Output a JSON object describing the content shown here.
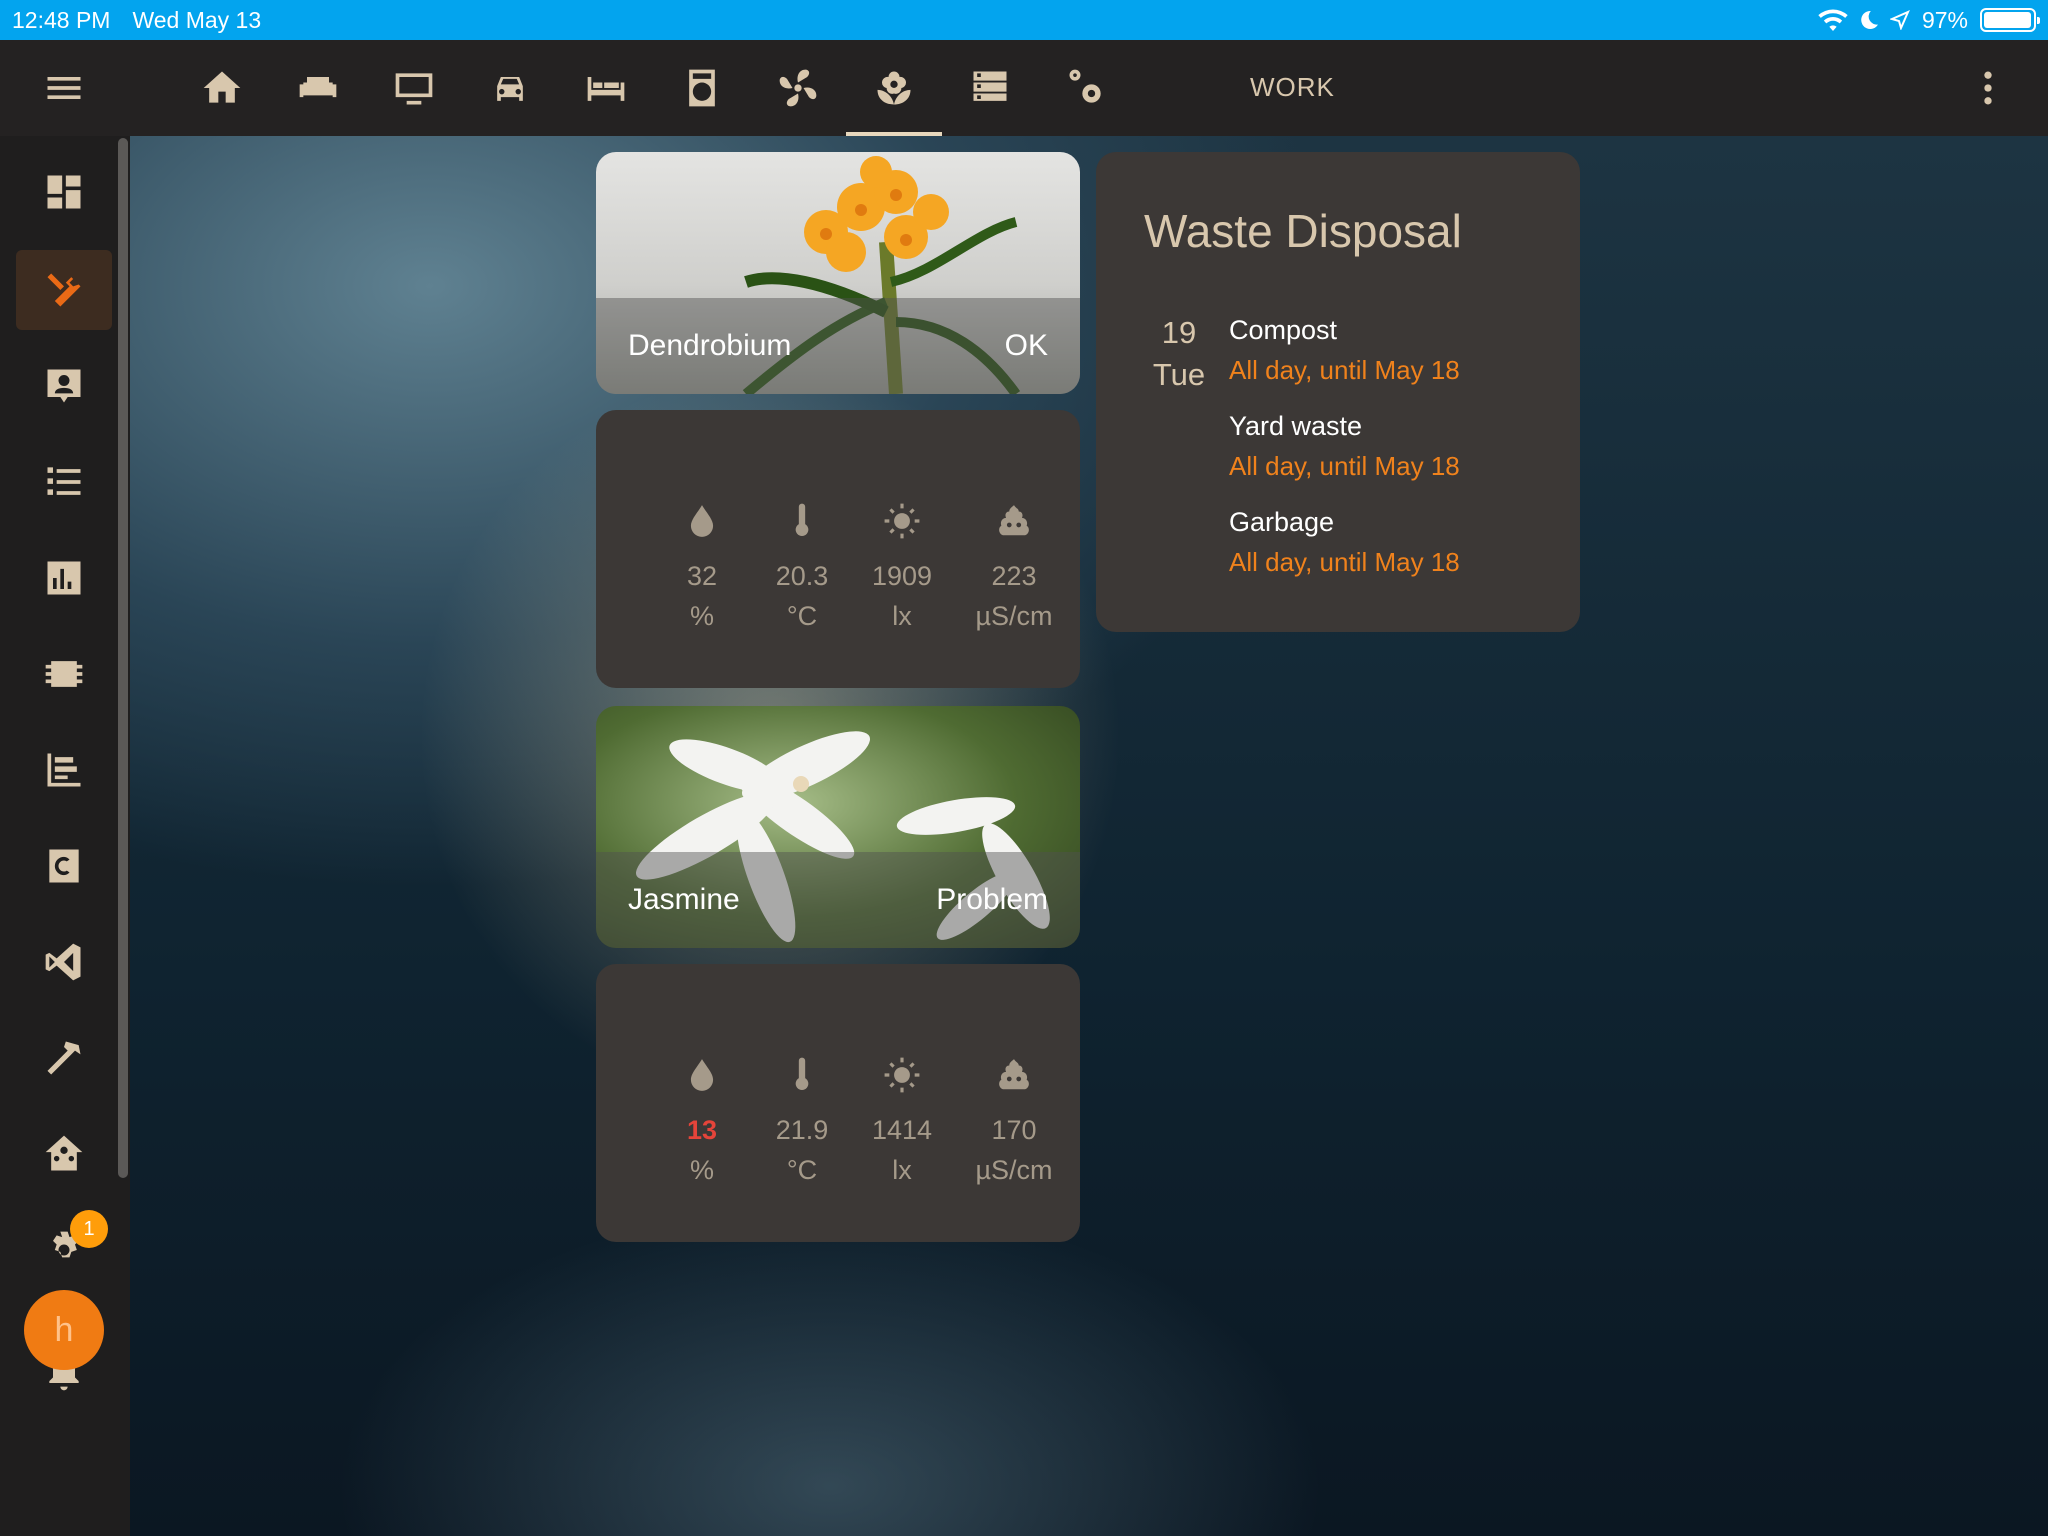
{
  "status": {
    "time": "12:48 PM",
    "date": "Wed May 13",
    "battery": "97%",
    "battery_level": 0.97
  },
  "toolbar": {
    "view_label": "WORK",
    "tabs": [
      "home-icon",
      "sofa-icon",
      "monitor-icon",
      "car-icon",
      "bed-icon",
      "washing-machine-icon",
      "fan-icon",
      "flower-icon",
      "server-icon",
      "cogs-icon"
    ],
    "active_tab": "flower-icon"
  },
  "sidebar": {
    "items": [
      "dashboard-icon",
      "tools-icon",
      "account-box-icon",
      "list-icon",
      "chart-icon",
      "chip-icon",
      "timeline-icon",
      "c-icon",
      "vscode-icon",
      "hammer-icon",
      "home-assistant-icon",
      "settings-icon"
    ],
    "active": "tools-icon",
    "notification_count": "1",
    "avatar_letter": "h"
  },
  "plants": [
    {
      "name": "Dendrobium",
      "status": "OK",
      "moisture": "32",
      "moisture_unit": "%",
      "temperature": "20.3",
      "temperature_unit": "°C",
      "illuminance": "1909",
      "illuminance_unit": "lx",
      "conductivity": "223",
      "conductivity_unit": "µS/cm"
    },
    {
      "name": "Jasmine",
      "status": "Problem",
      "moisture": "13",
      "moisture_unit": "%",
      "temperature": "21.9",
      "temperature_unit": "°C",
      "illuminance": "1414",
      "illuminance_unit": "lx",
      "conductivity": "170",
      "conductivity_unit": "µS/cm"
    }
  ],
  "waste": {
    "title": "Waste Disposal",
    "day": "19",
    "weekday": "Tue",
    "events": [
      {
        "name": "Compost",
        "when": "All day, until May 18"
      },
      {
        "name": "Yard waste",
        "when": "All day, until May 18"
      },
      {
        "name": "Garbage",
        "when": "All day, until May 18"
      }
    ]
  },
  "colors": {
    "accent": "#f0821c",
    "alert": "#e5443a",
    "statusbar": "#03a4ee",
    "card": "#3c3836"
  }
}
